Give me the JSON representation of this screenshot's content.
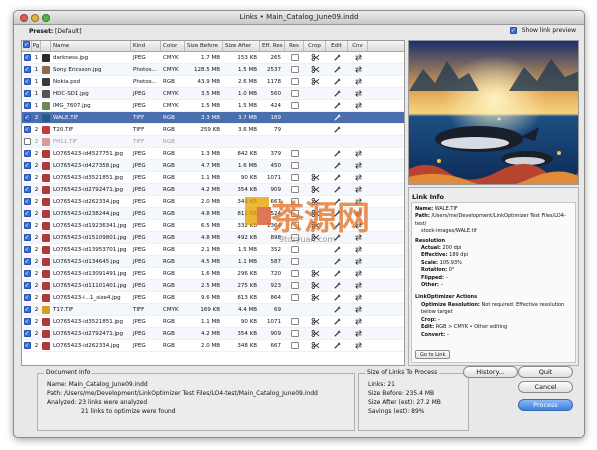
{
  "window": {
    "title": "Links • Main_Catalog_June09.indd"
  },
  "preset": {
    "label": "Preset:",
    "value": "[Default]"
  },
  "show_preview": {
    "label": "Show link preview",
    "checked": true
  },
  "table": {
    "headers": {
      "pg": "Pg",
      "name": "Name",
      "kind": "Kind",
      "color": "Color",
      "size_before": "Size Before",
      "size_after": "Size After",
      "eff_res": "Eff. Res",
      "res": "Res",
      "crop": "Crop",
      "edit": "Edit",
      "cnv": "Cnv"
    },
    "rows": [
      {
        "pg": "1",
        "name": "darkness.jpg",
        "kind": "JPEG",
        "color": "CMYK",
        "size_before": "1.7 MB",
        "size_after": "153 KB",
        "eff_res": "265",
        "res": true,
        "crop": true,
        "edit": true,
        "cnv": true,
        "checked": true,
        "thumb": "#2b2b2b"
      },
      {
        "pg": "1",
        "name": "Sony Ericsson.jpg",
        "kind": "Photos...",
        "color": "CMYK",
        "size_before": "128.5 MB",
        "size_after": "1.5 MB",
        "eff_res": "2537",
        "res": true,
        "crop": true,
        "edit": true,
        "cnv": true,
        "checked": true,
        "thumb": "#8a6a4a"
      },
      {
        "pg": "1",
        "name": "Nokia.psd",
        "kind": "Photos...",
        "color": "RGB",
        "size_before": "43.9 MB",
        "size_after": "2.6 MB",
        "eff_res": "1178",
        "res": true,
        "crop": true,
        "edit": true,
        "cnv": true,
        "checked": true,
        "thumb": "#3a3a3a"
      },
      {
        "pg": "1",
        "name": "HDC-SD1.jpg",
        "kind": "JPEG",
        "color": "CMYK",
        "size_before": "3.5 MB",
        "size_after": "1.0 MB",
        "eff_res": "560",
        "res": true,
        "crop": false,
        "edit": true,
        "cnv": true,
        "checked": true,
        "thumb": "#555555"
      },
      {
        "pg": "1",
        "name": "IMG_7607.jpg",
        "kind": "JPEG",
        "color": "CMYK",
        "size_before": "1.5 MB",
        "size_after": "1.5 MB",
        "eff_res": "424",
        "res": true,
        "crop": false,
        "edit": true,
        "cnv": true,
        "checked": true,
        "thumb": "#6a8a5a"
      },
      {
        "pg": "2",
        "name": "WALE.TIF",
        "kind": "TIFF",
        "color": "RGB",
        "size_before": "3.3 MB",
        "size_after": "3.7 MB",
        "eff_res": "189",
        "res": false,
        "crop": false,
        "edit": true,
        "cnv": false,
        "checked": true,
        "thumb": "#2a5a8a",
        "selected": true
      },
      {
        "pg": "2",
        "name": "T20.TIF",
        "kind": "TIFF",
        "color": "RGB",
        "size_before": "259 KB",
        "size_after": "3.6 MB",
        "eff_res": "79",
        "res": false,
        "crop": false,
        "edit": true,
        "cnv": false,
        "checked": true,
        "thumb": "#c43a3a"
      },
      {
        "pg": "2",
        "name": "FH11.TIF",
        "kind": "TIFF",
        "color": "RGB",
        "size_before": "",
        "size_after": "",
        "eff_res": "",
        "res": false,
        "crop": false,
        "edit": false,
        "cnv": false,
        "checked": false,
        "thumb": "#d89a9a",
        "dim": true
      },
      {
        "pg": "2",
        "name": "LO765423-id4527751.jpg",
        "kind": "JPEG",
        "color": "RGB",
        "size_before": "1.3 MB",
        "size_after": "842 KB",
        "eff_res": "379",
        "res": true,
        "crop": false,
        "edit": true,
        "cnv": true,
        "checked": true,
        "thumb": "#b03a3a"
      },
      {
        "pg": "2",
        "name": "LO765423-id427358.jpg",
        "kind": "JPEG",
        "color": "RGB",
        "size_before": "4.7 MB",
        "size_after": "1.6 MB",
        "eff_res": "450",
        "res": true,
        "crop": false,
        "edit": true,
        "cnv": true,
        "checked": true,
        "thumb": "#b03a3a"
      },
      {
        "pg": "2",
        "name": "LO765423-id3521851.jpg",
        "kind": "JPEG",
        "color": "RGB",
        "size_before": "1.1 MB",
        "size_after": "90 KB",
        "eff_res": "1071",
        "res": true,
        "crop": true,
        "edit": true,
        "cnv": true,
        "checked": true,
        "thumb": "#b03a3a"
      },
      {
        "pg": "2",
        "name": "LO765423-id2792471.jpg",
        "kind": "JPEG",
        "color": "RGB",
        "size_before": "4.2 MB",
        "size_after": "354 KB",
        "eff_res": "909",
        "res": true,
        "crop": true,
        "edit": true,
        "cnv": true,
        "checked": true,
        "thumb": "#b03a3a"
      },
      {
        "pg": "2",
        "name": "LO765423-id262334.jpg",
        "kind": "JPEG",
        "color": "RGB",
        "size_before": "2.0 MB",
        "size_after": "348 KB",
        "eff_res": "667",
        "res": true,
        "crop": true,
        "edit": true,
        "cnv": true,
        "checked": true,
        "thumb": "#b03a3a"
      },
      {
        "pg": "2",
        "name": "LO765423-id238244.jpg",
        "kind": "JPEG",
        "color": "RGB",
        "size_before": "4.8 MB",
        "size_after": "812 KB",
        "eff_res": "524",
        "res": true,
        "crop": true,
        "edit": true,
        "cnv": true,
        "checked": true,
        "thumb": "#b03a3a"
      },
      {
        "pg": "2",
        "name": "LO765423-id19236341.jpg",
        "kind": "JPEG",
        "color": "RGB",
        "size_before": "6.5 MB",
        "size_after": "332 KB",
        "eff_res": "1364",
        "res": true,
        "crop": true,
        "edit": true,
        "cnv": true,
        "checked": true,
        "thumb": "#b03a3a"
      },
      {
        "pg": "2",
        "name": "LO765423-id15109801.jpg",
        "kind": "JPEG",
        "color": "RGB",
        "size_before": "4.8 MB",
        "size_after": "492 KB",
        "eff_res": "898",
        "res": true,
        "crop": true,
        "edit": true,
        "cnv": true,
        "checked": true,
        "thumb": "#b03a3a"
      },
      {
        "pg": "2",
        "name": "LO765423-id13953701.jpg",
        "kind": "JPEG",
        "color": "RGB",
        "size_before": "2.1 MB",
        "size_after": "1.5 MB",
        "eff_res": "352",
        "res": true,
        "crop": false,
        "edit": true,
        "cnv": true,
        "checked": true,
        "thumb": "#b03a3a"
      },
      {
        "pg": "2",
        "name": "LO765423-id134645.jpg",
        "kind": "JPEG",
        "color": "RGB",
        "size_before": "4.5 MB",
        "size_after": "1.1 MB",
        "eff_res": "587",
        "res": true,
        "crop": false,
        "edit": true,
        "cnv": true,
        "checked": true,
        "thumb": "#b03a3a"
      },
      {
        "pg": "2",
        "name": "LO765423-id13091491.jpg",
        "kind": "JPEG",
        "color": "RGB",
        "size_before": "1.6 MB",
        "size_after": "296 KB",
        "eff_res": "720",
        "res": true,
        "crop": true,
        "edit": true,
        "cnv": true,
        "checked": true,
        "thumb": "#b03a3a"
      },
      {
        "pg": "2",
        "name": "LO765423-id11101401.jpg",
        "kind": "JPEG",
        "color": "RGB",
        "size_before": "2.5 MB",
        "size_after": "275 KB",
        "eff_res": "923",
        "res": true,
        "crop": true,
        "edit": true,
        "cnv": true,
        "checked": true,
        "thumb": "#b03a3a"
      },
      {
        "pg": "2",
        "name": "LO765423-i...1_size4.jpg",
        "kind": "JPEG",
        "color": "RGB",
        "size_before": "9.6 MB",
        "size_after": "813 KB",
        "eff_res": "864",
        "res": true,
        "crop": true,
        "edit": true,
        "cnv": true,
        "checked": true,
        "thumb": "#b03a3a"
      },
      {
        "pg": "2",
        "name": "T17.TIF",
        "kind": "TIFF",
        "color": "CMYK",
        "size_before": "169 KB",
        "size_after": "4.4 MB",
        "eff_res": "69",
        "res": false,
        "crop": false,
        "edit": true,
        "cnv": true,
        "checked": true,
        "thumb": "#d4a020"
      },
      {
        "pg": "2",
        "name": "LO765423-id3521851.jpg",
        "kind": "JPEG",
        "color": "RGB",
        "size_before": "1.1 MB",
        "size_after": "90 KB",
        "eff_res": "1071",
        "res": true,
        "crop": true,
        "edit": true,
        "cnv": true,
        "checked": true,
        "thumb": "#b03a3a"
      },
      {
        "pg": "2",
        "name": "LO765423-id2792471.jpg",
        "kind": "JPEG",
        "color": "RGB",
        "size_before": "4.2 MB",
        "size_after": "354 KB",
        "eff_res": "909",
        "res": true,
        "crop": true,
        "edit": true,
        "cnv": true,
        "checked": true,
        "thumb": "#b03a3a"
      },
      {
        "pg": "2",
        "name": "LO765423-id262334.jpg",
        "kind": "JPEG",
        "color": "RGB",
        "size_before": "2.0 MB",
        "size_after": "348 KB",
        "eff_res": "667",
        "res": true,
        "crop": true,
        "edit": true,
        "cnv": true,
        "checked": true,
        "thumb": "#b03a3a"
      }
    ]
  },
  "link_info": {
    "title": "Link Info",
    "name_label": "Name:",
    "name_value": "WALE.TIF",
    "path_label": "Path:",
    "path_value": "/Users/me/Development/LinkOptimizer Test Files/LO4-test/",
    "path_value2": "stock-images/WALE.tif",
    "resolution_label": "Resolution",
    "actual_label": "Actual:",
    "actual_value": "200 dpi",
    "effective_label": "Effective:",
    "effective_value": "189 dpi",
    "scale_label": "Scale:",
    "scale_value": "105.93%",
    "rotation_label": "Rotation:",
    "rotation_value": "0°",
    "flipped_label": "Flipped:",
    "flipped_value": "–",
    "other_label": "Other:",
    "other_value": "–",
    "actions_label": "LinkOptimizer Actions",
    "optres_label": "Optimize Resolution:",
    "optres_value": "Not required: Effective resolution below target",
    "crop_label": "Crop:",
    "crop_value": "–",
    "edit_label": "Edit:",
    "edit_value": "RGB > CMYK • Other editing",
    "convert_label": "Convert:",
    "convert_value": "–",
    "goto_button": "Go to Link"
  },
  "document_info": {
    "title": "Document Info",
    "name_label": "Name:",
    "name_value": "Main_Catalog_June09.indd",
    "path_label": "Path:",
    "path_value": "/Users/me/Development/LinkOptimizer Test Files/LO4-test/Main_Catalog_June09.indd",
    "analyzed_label": "Analyzed:",
    "analyzed_line1": "23 links were analyzed",
    "analyzed_line2": "21 links to optimize were found"
  },
  "size_info": {
    "title": "Size of Links To Process",
    "links": "Links: 21",
    "size_before": "Size Before: 235.4 MB",
    "size_after": "Size After (est): 27.2 MB",
    "savings": "Savings (est): 89%"
  },
  "buttons": {
    "history": "History...",
    "quit": "Quit",
    "cancel": "Cancel",
    "process": "Process"
  },
  "watermark": {
    "text": "茶源网",
    "url": "9tczyuan.com"
  },
  "colors": {
    "selection": "#4b6fae",
    "accent": "#3b7fe0",
    "checkbox": "#3a6fd8"
  }
}
